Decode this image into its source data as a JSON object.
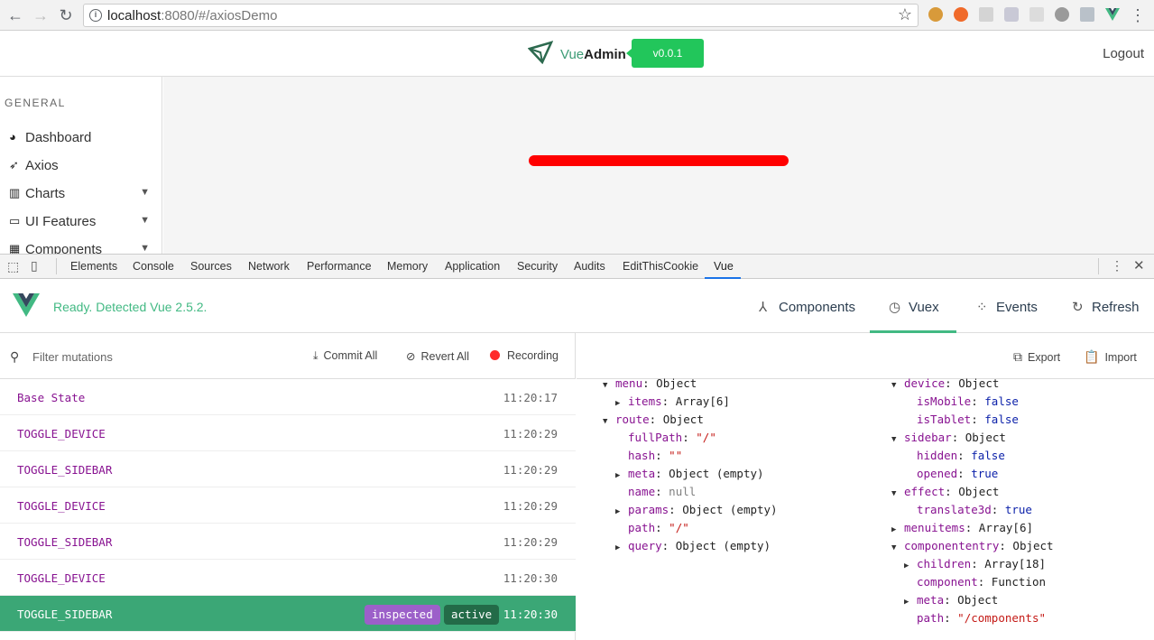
{
  "browser": {
    "url_host": "localhost",
    "url_rest": ":8080/#/axiosDemo"
  },
  "app": {
    "brand_vue": "Vue",
    "brand_admin": "Admin",
    "version": "v0.0.1",
    "logout": "Logout"
  },
  "sidebar": {
    "section": "GENERAL",
    "items": [
      {
        "label": "Dashboard",
        "icon": "dashboard-icon",
        "expandable": false
      },
      {
        "label": "Axios",
        "icon": "rocket-icon",
        "expandable": false
      },
      {
        "label": "Charts",
        "icon": "bar-chart-icon",
        "expandable": true
      },
      {
        "label": "UI Features",
        "icon": "laptop-icon",
        "expandable": true
      },
      {
        "label": "Components",
        "icon": "building-icon",
        "expandable": true
      }
    ]
  },
  "devtools": {
    "tabs": [
      "Elements",
      "Console",
      "Sources",
      "Network",
      "Performance",
      "Memory",
      "Application",
      "Security",
      "Audits",
      "EditThisCookie",
      "Vue"
    ],
    "active_tab": "Vue"
  },
  "vue_devtools": {
    "status": "Ready. Detected Vue 2.5.2.",
    "tabs": {
      "components": "Components",
      "vuex": "Vuex",
      "events": "Events",
      "refresh": "Refresh"
    },
    "active_tab": "Vuex"
  },
  "mutations": {
    "filter_placeholder": "Filter mutations",
    "commit_all": "Commit All",
    "revert_all": "Revert All",
    "recording": "Recording",
    "list": [
      {
        "name": "Base State",
        "time": "11:20:17"
      },
      {
        "name": "TOGGLE_DEVICE",
        "time": "11:20:29"
      },
      {
        "name": "TOGGLE_SIDEBAR",
        "time": "11:20:29"
      },
      {
        "name": "TOGGLE_DEVICE",
        "time": "11:20:29"
      },
      {
        "name": "TOGGLE_SIDEBAR",
        "time": "11:20:29"
      },
      {
        "name": "TOGGLE_DEVICE",
        "time": "11:20:30"
      },
      {
        "name": "TOGGLE_SIDEBAR",
        "time": "11:20:30",
        "selected": true,
        "badges": [
          "inspected",
          "active"
        ]
      }
    ]
  },
  "state_inspector": {
    "export": "Export",
    "import": "Import",
    "left_column": [
      {
        "indent": 0,
        "arrow": "down",
        "key": "menu",
        "value": "Object",
        "vtype": "typ"
      },
      {
        "indent": 1,
        "arrow": "right",
        "key": "items",
        "value": "Array[6]",
        "vtype": "typ"
      },
      {
        "indent": 0,
        "arrow": "down",
        "key": "route",
        "value": "Object",
        "vtype": "typ"
      },
      {
        "indent": 1,
        "arrow": "",
        "key": "fullPath",
        "value": "\"/\"",
        "vtype": "str"
      },
      {
        "indent": 1,
        "arrow": "",
        "key": "hash",
        "value": "\"\"",
        "vtype": "str"
      },
      {
        "indent": 1,
        "arrow": "right",
        "key": "meta",
        "value": "Object (empty)",
        "vtype": "typ"
      },
      {
        "indent": 1,
        "arrow": "",
        "key": "name",
        "value": "null",
        "vtype": "nul"
      },
      {
        "indent": 1,
        "arrow": "right",
        "key": "params",
        "value": "Object (empty)",
        "vtype": "typ"
      },
      {
        "indent": 1,
        "arrow": "",
        "key": "path",
        "value": "\"/\"",
        "vtype": "str"
      },
      {
        "indent": 1,
        "arrow": "right",
        "key": "query",
        "value": "Object (empty)",
        "vtype": "typ"
      }
    ],
    "right_column": [
      {
        "indent": 0,
        "arrow": "down",
        "key": "device",
        "value": "Object",
        "vtype": "typ"
      },
      {
        "indent": 1,
        "arrow": "",
        "key": "isMobile",
        "value": "false",
        "vtype": "bool"
      },
      {
        "indent": 1,
        "arrow": "",
        "key": "isTablet",
        "value": "false",
        "vtype": "bool"
      },
      {
        "indent": 0,
        "arrow": "down",
        "key": "sidebar",
        "value": "Object",
        "vtype": "typ"
      },
      {
        "indent": 1,
        "arrow": "",
        "key": "hidden",
        "value": "false",
        "vtype": "bool"
      },
      {
        "indent": 1,
        "arrow": "",
        "key": "opened",
        "value": "true",
        "vtype": "bool"
      },
      {
        "indent": 0,
        "arrow": "down",
        "key": "effect",
        "value": "Object",
        "vtype": "typ"
      },
      {
        "indent": 1,
        "arrow": "",
        "key": "translate3d",
        "value": "true",
        "vtype": "bool"
      },
      {
        "indent": 0,
        "arrow": "right",
        "key": "menuitems",
        "value": "Array[6]",
        "vtype": "typ"
      },
      {
        "indent": 0,
        "arrow": "down",
        "key": "componententry",
        "value": "Object",
        "vtype": "typ"
      },
      {
        "indent": 1,
        "arrow": "right",
        "key": "children",
        "value": "Array[18]",
        "vtype": "typ"
      },
      {
        "indent": 1,
        "arrow": "",
        "key": "component",
        "value": "Function",
        "vtype": "typ"
      },
      {
        "indent": 1,
        "arrow": "right",
        "key": "meta",
        "value": "Object",
        "vtype": "typ"
      },
      {
        "indent": 1,
        "arrow": "",
        "key": "path",
        "value": "\"/components\"",
        "vtype": "str"
      }
    ]
  }
}
